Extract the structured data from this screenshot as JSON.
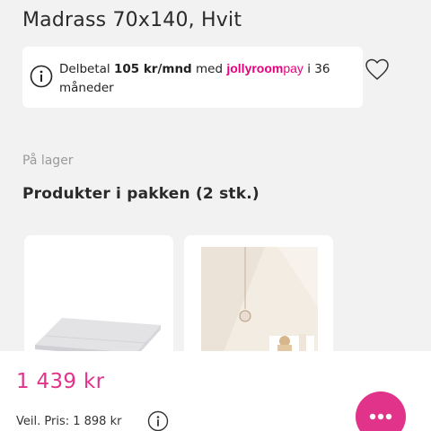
{
  "product": {
    "title": "Madrass 70x140, Hvit"
  },
  "installment": {
    "icon": "info-icon",
    "prefix": "Delbetal ",
    "amount": "105 kr/mnd",
    "middle": " med ",
    "brand_main": "jollyroom",
    "brand_suffix": "pay",
    "suffix": " i 36 måneder"
  },
  "wishlist": {
    "icon": "heart-icon"
  },
  "stock_status": "På lager",
  "package": {
    "title": "Produkter i pakken (2 stk.)",
    "items": [
      {
        "image": "mattress-image"
      },
      {
        "image": "nursery-room-image"
      }
    ]
  },
  "pricing": {
    "price": "1 439 kr",
    "rrp_label": "Veil. Pris: 1 898 kr",
    "rrp_icon": "info-icon"
  },
  "fab": {
    "icon": "more-dots-icon"
  },
  "colors": {
    "accent": "#e2338a",
    "brand": "#e6007e",
    "background": "#f2f2f2"
  }
}
